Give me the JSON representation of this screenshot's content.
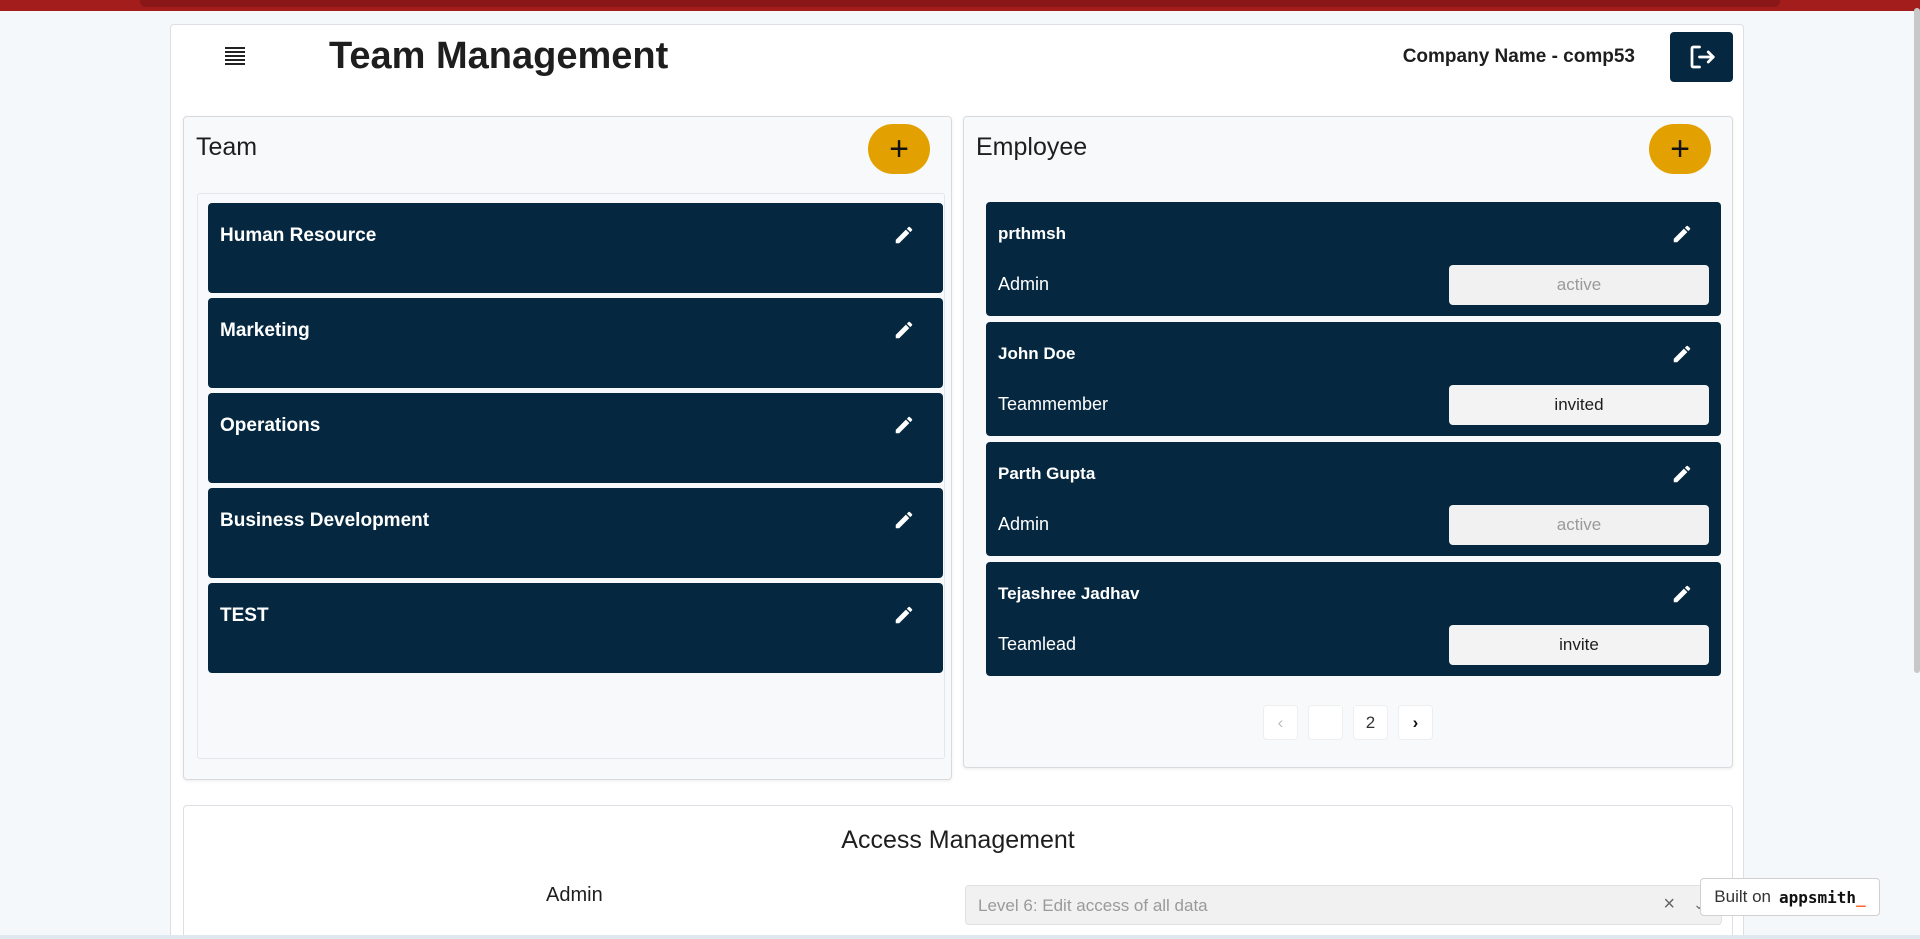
{
  "header": {
    "title": "Team Management",
    "company_label": "Company Name - comp53"
  },
  "team_panel": {
    "title": "Team",
    "add_label": "+",
    "teams": [
      {
        "name": "Human Resource"
      },
      {
        "name": "Marketing"
      },
      {
        "name": "Operations"
      },
      {
        "name": "Business Development"
      },
      {
        "name": "TEST"
      }
    ]
  },
  "employee_panel": {
    "title": "Employee",
    "add_label": "+",
    "employees": [
      {
        "name": "prthmsh",
        "role": "Admin",
        "status": "active"
      },
      {
        "name": "John Doe",
        "role": "Teammember",
        "status": "invited"
      },
      {
        "name": "Parth Gupta",
        "role": "Admin",
        "status": "active"
      },
      {
        "name": "Tejashree Jadhav",
        "role": "Teamlead",
        "status": "invite"
      }
    ],
    "pagination": {
      "prev": "‹",
      "current": "",
      "next_page": "2",
      "next": "›"
    }
  },
  "access": {
    "title": "Access Management",
    "role": "Admin",
    "select_value": "Level 6: Edit access of all data",
    "clear": "×",
    "chevron": "⌄"
  },
  "badge": {
    "built_on": "Built on",
    "brand": "appsmith",
    "cursor": "_"
  },
  "colors": {
    "card": "#052840",
    "accent": "#e2a100",
    "top_strip": "#a31d1d"
  }
}
